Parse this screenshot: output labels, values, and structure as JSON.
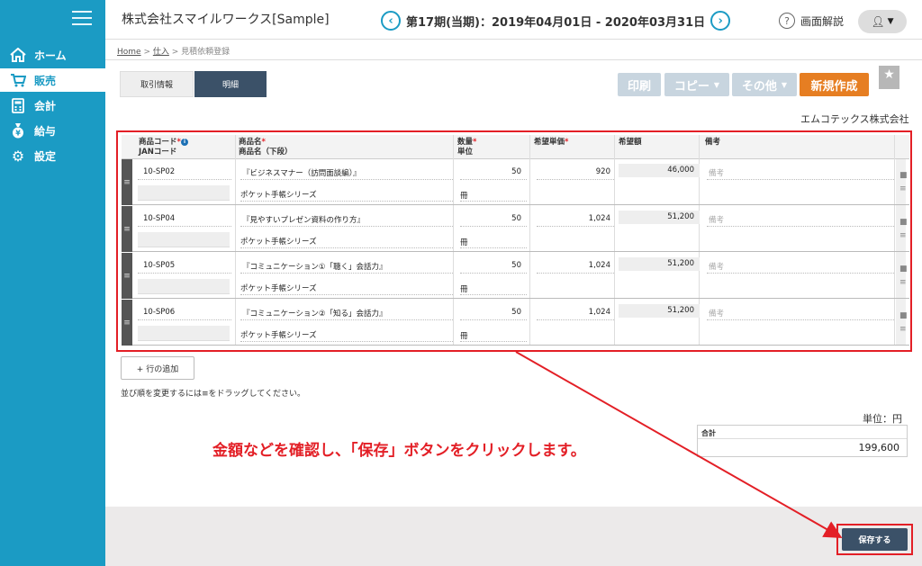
{
  "sidebar": {
    "items": [
      {
        "label": "ホーム",
        "icon": "home-icon"
      },
      {
        "label": "販売",
        "icon": "cart-icon"
      },
      {
        "label": "会計",
        "icon": "calculator-icon"
      },
      {
        "label": "給与",
        "icon": "money-bag-icon"
      },
      {
        "label": "設定",
        "icon": "gear-icon"
      }
    ]
  },
  "header": {
    "company": "株式会社スマイルワークス[Sample]",
    "period": "第17期(当期)：2019年04月01日 - 2020年03月31日",
    "help_label": "画面解説"
  },
  "breadcrumb": {
    "home": "Home",
    "sep1": " > ",
    "purchase": "仕入",
    "sep2": " > ",
    "current": "見積依頼登録"
  },
  "tabs": {
    "torihiki": "取引情報",
    "meisai": "明細"
  },
  "toolbar": {
    "print": "印刷",
    "copy": "コピー",
    "other": "その他",
    "new": "新規作成"
  },
  "partner": "エムコテックス株式会社",
  "table": {
    "headers": {
      "code": "商品コード",
      "jan": "JANコード",
      "name": "商品名",
      "name2": "商品名（下段）",
      "qty": "数量",
      "unit": "単位",
      "price": "希望単価",
      "amount": "希望額",
      "memo": "備考"
    },
    "rows": [
      {
        "code": "10-SP02",
        "name": "『ビジネスマナー（訪問面談編）』",
        "name2": "ポケット手帳シリーズ",
        "qty": "50",
        "unit": "冊",
        "price": "920",
        "amount": "46,000",
        "memo": "備考"
      },
      {
        "code": "10-SP04",
        "name": "『見やすいプレゼン資料の作り方』",
        "name2": "ポケット手帳シリーズ",
        "qty": "50",
        "unit": "冊",
        "price": "1,024",
        "amount": "51,200",
        "memo": "備考"
      },
      {
        "code": "10-SP05",
        "name": "『コミュニケーション①「聴く」会話力』",
        "name2": "ポケット手帳シリーズ",
        "qty": "50",
        "unit": "冊",
        "price": "1,024",
        "amount": "51,200",
        "memo": "備考"
      },
      {
        "code": "10-SP06",
        "name": "『コミュニケーション②「知る」会話力』",
        "name2": "ポケット手帳シリーズ",
        "qty": "50",
        "unit": "冊",
        "price": "1,024",
        "amount": "51,200",
        "memo": "備考"
      }
    ]
  },
  "add_row_label": "+ 行の追加",
  "drag_note": "並び順を変更するには≡をドラッグしてください。",
  "unit_label": "単位：円",
  "total": {
    "label": "合計",
    "value": "199,600"
  },
  "annotation": "金額などを確認し、「保存」ボタンをクリックします。",
  "save_label": "保存する",
  "colors": {
    "sidebar": "#1b9bc4",
    "accent_orange": "#e67e22",
    "highlight_red": "#e31f26",
    "navy": "#3b5168"
  }
}
